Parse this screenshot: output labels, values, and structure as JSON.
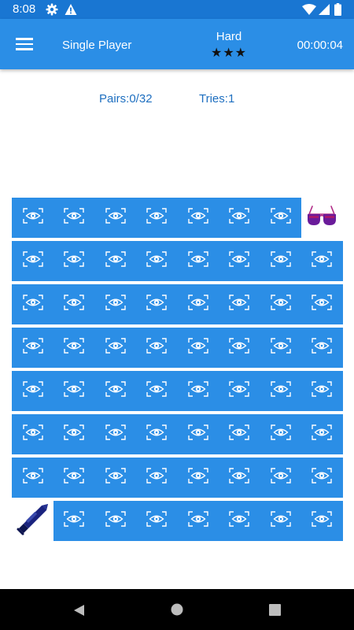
{
  "status_bar": {
    "time": "8:08"
  },
  "app_bar": {
    "title": "Single Player",
    "difficulty": "Hard",
    "stars": "★★★",
    "timer": "00:00:04"
  },
  "stats": {
    "pairs": "Pairs:0/32",
    "tries": "Tries:1"
  },
  "board": {
    "rows": 8,
    "cols": 8,
    "card_back_icon": "eye-scan-icon",
    "revealed": [
      {
        "row": 0,
        "col": 7,
        "icon": "sunglasses-icon"
      },
      {
        "row": 7,
        "col": 0,
        "icon": "trumpet-icon"
      }
    ]
  },
  "colors": {
    "status_bar": "#1976d2",
    "app_bar": "#2b8ee6",
    "card_back": "#2b8ee6",
    "stats_text": "#1e6fc0",
    "nav_bar": "#000000"
  }
}
